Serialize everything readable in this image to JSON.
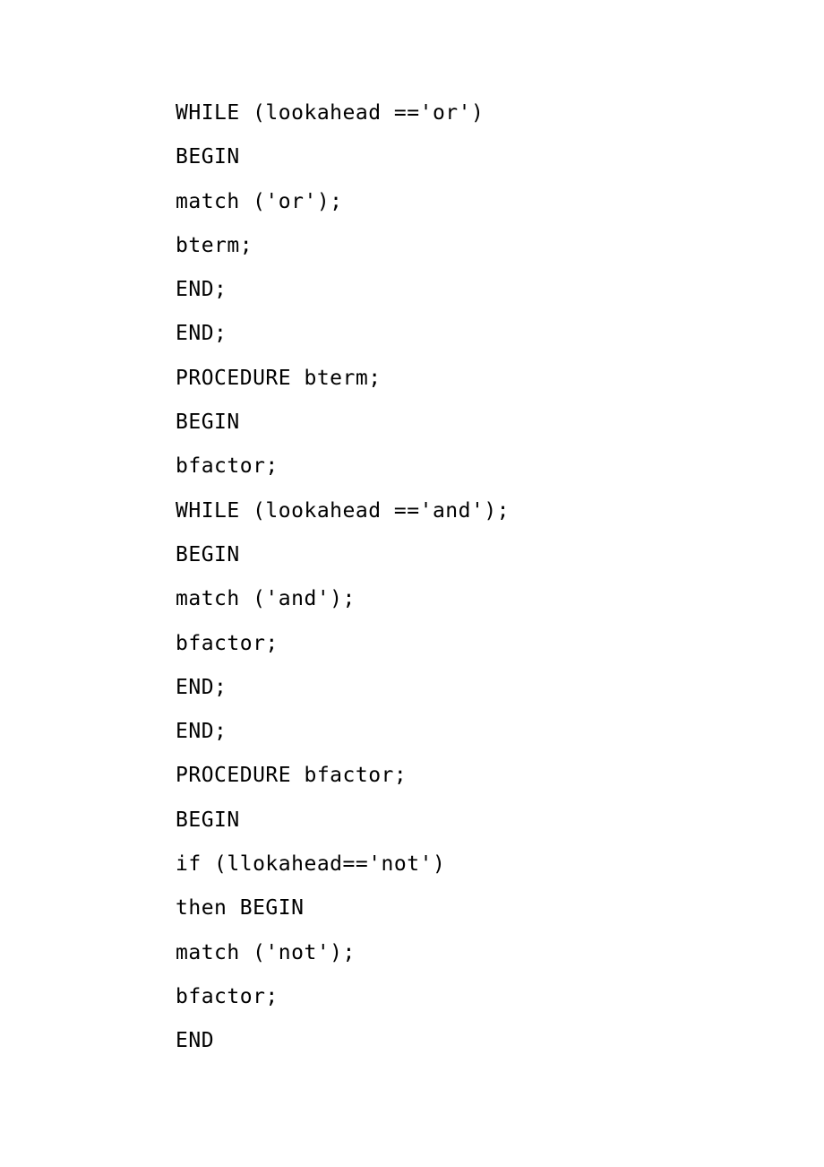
{
  "lines": [
    "WHILE (lookahead =='or')",
    "BEGIN",
    "match ('or');",
    "bterm;",
    "END;",
    "END;",
    "PROCEDURE bterm;",
    "BEGIN",
    "bfactor;",
    "WHILE (lookahead =='and');",
    "BEGIN",
    "match ('and');",
    "bfactor;",
    "END;",
    "END;",
    "PROCEDURE bfactor;",
    "BEGIN",
    "if (llokahead=='not')",
    "then BEGIN",
    "match ('not');",
    "bfactor;",
    "END"
  ]
}
